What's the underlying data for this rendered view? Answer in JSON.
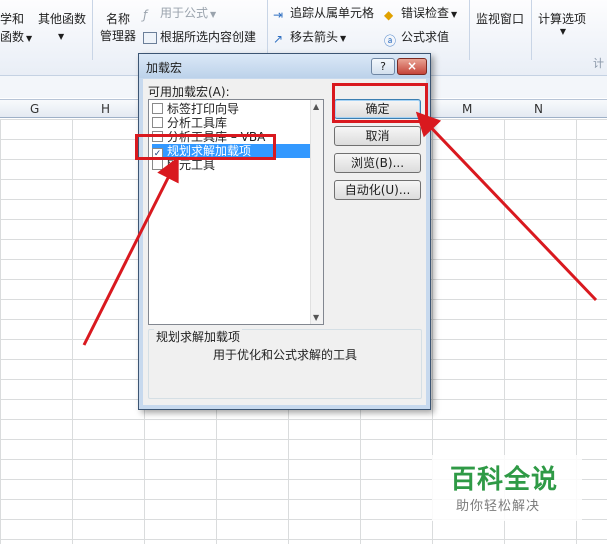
{
  "ribbon": {
    "math_label": "学和",
    "math_label2": "函数",
    "other_funcs": "其他函数",
    "name_mgr_1": "名称",
    "name_mgr_2": "管理器",
    "use_in_formula": "用于公式",
    "create_from_sel": "根据所选内容创建",
    "trace_precedents": "追踪从属单元格",
    "remove_arrows": "移去箭头",
    "error_check": "错误检查",
    "eval_formula": "公式求值",
    "watch_window": "监视窗口",
    "calc_options": "计算选项",
    "calc_group": "计"
  },
  "columns": [
    "G",
    "H",
    "M",
    "N"
  ],
  "dialog": {
    "title": "加载宏",
    "help": "?",
    "close": "×",
    "available_label": "可用加载宏(A):",
    "items": [
      {
        "label": "标签打印向导",
        "checked": false,
        "selected": false
      },
      {
        "label": "分析工具库",
        "checked": false,
        "selected": false
      },
      {
        "label": "分析工具库 – VBA",
        "checked": false,
        "selected": false
      },
      {
        "label": "规划求解加载项",
        "checked": true,
        "selected": true
      },
      {
        "label": "欧元工具",
        "checked": false,
        "selected": false
      }
    ],
    "ok": "确定",
    "cancel": "取消",
    "browse": "浏览(B)...",
    "automation": "自动化(U)...",
    "desc_title": "规划求解加载项",
    "desc_text": "用于优化和公式求解的工具"
  },
  "watermark": {
    "title": "百科全说",
    "subtitle": "助你轻松解决"
  },
  "colors": {
    "highlight": "#d9191f",
    "watermark_green": "#2f9a46",
    "selection": "#3399ff"
  }
}
